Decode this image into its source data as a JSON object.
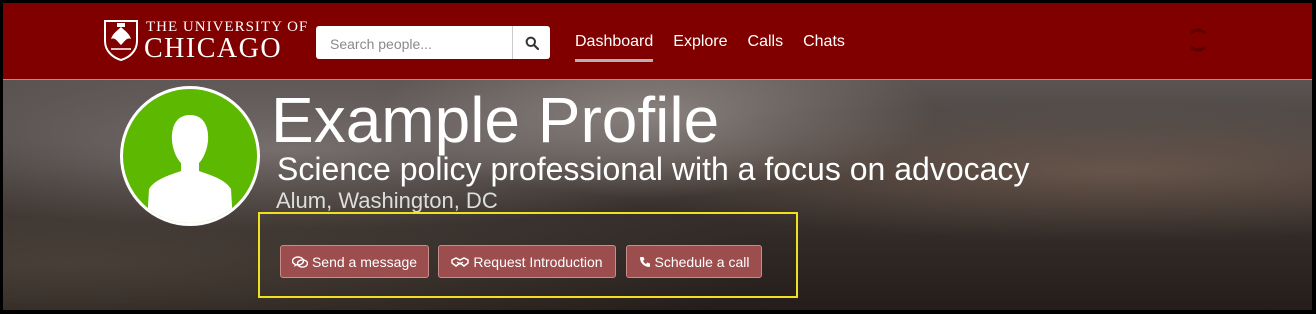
{
  "header": {
    "logo": {
      "line1": "THE UNIVERSITY OF",
      "line2": "CHICAGO"
    },
    "search": {
      "placeholder": "Search people...",
      "button_icon": "search-icon"
    },
    "nav": [
      {
        "label": "Dashboard",
        "active": true
      },
      {
        "label": "Explore"
      },
      {
        "label": "Calls"
      },
      {
        "label": "Chats"
      }
    ]
  },
  "profile": {
    "name": "Example Profile",
    "tagline": "Science policy professional with a focus on advocacy",
    "location": "Alum, Washington, DC",
    "avatar_icon": "person-silhouette-icon"
  },
  "actions": [
    {
      "label": "Send a message",
      "icon": "chat-bubbles-icon"
    },
    {
      "label": "Request Introduction",
      "icon": "handshake-icon"
    },
    {
      "label": "Schedule a call",
      "icon": "phone-icon"
    }
  ],
  "colors": {
    "header_bg": "#800000",
    "button_bg": "#9c4e4e",
    "avatar_bg": "#5cb800",
    "highlight": "#f0e020"
  }
}
